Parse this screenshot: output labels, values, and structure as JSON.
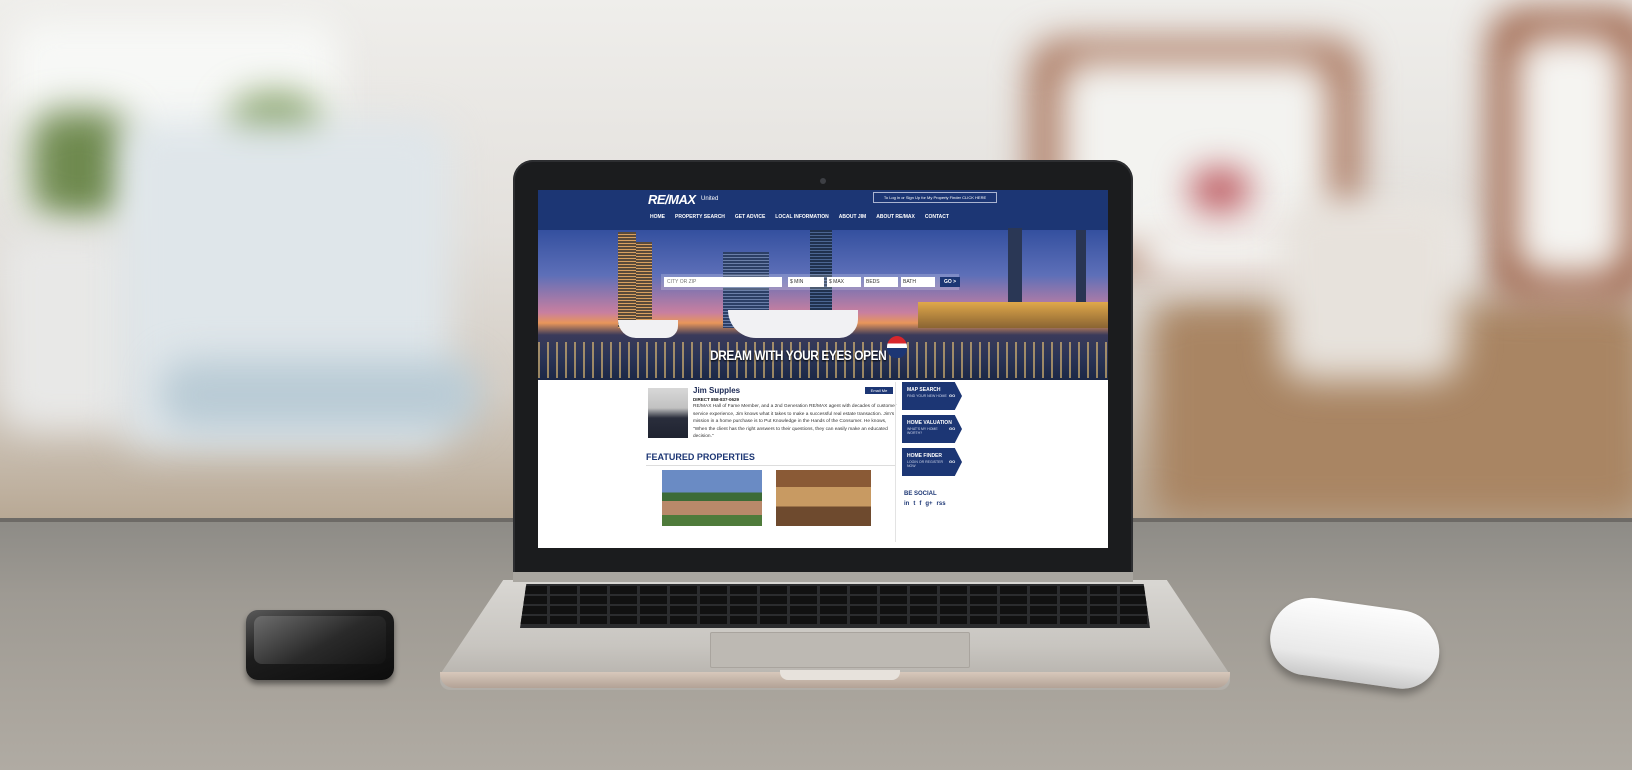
{
  "site": {
    "logo": "RE/MAX",
    "logo_sub": "United",
    "login_prompt": "To Log in or Sign Up for My Property Finder CLICK HERE",
    "nav": [
      "HOME",
      "PROPERTY SEARCH",
      "GET ADVICE",
      "LOCAL INFORMATION",
      "ABOUT JIM",
      "ABOUT RE/MAX",
      "CONTACT"
    ]
  },
  "search": {
    "placeholder": "CITY OR ZIP",
    "min_price": "$ MIN",
    "max_price": "$ MAX",
    "beds": "BEDS",
    "bath": "BATH",
    "go_label": "GO >"
  },
  "hero": {
    "tagline": "DREAM WITH YOUR EYES OPEN"
  },
  "agent": {
    "name": "Jim Supples",
    "email_button": "Email Me",
    "direct": "DIRECT 858-837-0629",
    "bio": "RE/MAX Hall of Fame Member, and a 2nd Generation RE/MAX agent with decades of customer service experience, Jim knows what it takes to make a successful real estate transaction. Jim's mission in a home purchase is to Put Knowledge in the Hands of the Consumer. He knows, \"When the client has the right answers to their questions, they can easily make an educated decision.\""
  },
  "featured": {
    "title": "FEATURED PROPERTIES"
  },
  "sidebar": {
    "buttons": [
      {
        "title": "MAP SEARCH",
        "subtitle": "FIND YOUR NEW HOME",
        "go": "GO"
      },
      {
        "title": "HOME VALUATION",
        "subtitle": "WHAT'S MY HOME WORTH?",
        "go": "GO"
      },
      {
        "title": "HOME FINDER",
        "subtitle": "LOGIN OR REGISTER NOW",
        "go": "GO"
      }
    ],
    "be_social": "BE SOCIAL",
    "social_icons": [
      "in",
      "t",
      "f",
      "g+",
      "rss"
    ]
  },
  "colors": {
    "brand_blue": "#1c3674",
    "brand_red": "#d7262c"
  }
}
